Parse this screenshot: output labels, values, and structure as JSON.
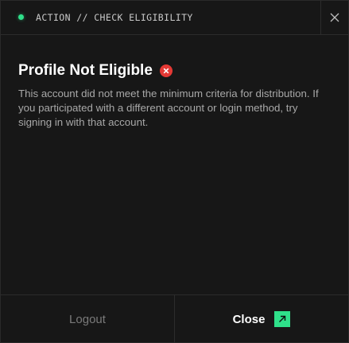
{
  "header": {
    "title": "ACTION // CHECK ELIGIBILITY",
    "status_color": "#2fe08a"
  },
  "content": {
    "title": "Profile Not Eligible",
    "status_icon": "error-x-circle-icon",
    "error_color": "#e53935",
    "description": "This account did not meet the minimum criteria for distribution. If you participated with a different account or login method, try signing in with that account."
  },
  "footer": {
    "logout_label": "Logout",
    "close_label": "Close",
    "close_icon": "arrow-up-right-icon",
    "accent_color": "#2fe08a"
  }
}
